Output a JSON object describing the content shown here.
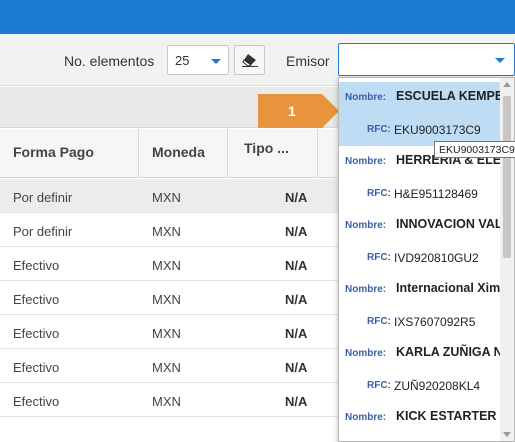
{
  "toolbar": {
    "no_elementos_label": "No. elementos",
    "page_size": "25",
    "emisor_label": "Emisor",
    "emisor_value": ""
  },
  "badge": {
    "label": "1"
  },
  "table": {
    "headers": [
      "Forma Pago",
      "Moneda",
      "Tipo ..."
    ],
    "rows": [
      {
        "forma": "Por definir",
        "moneda": "MXN",
        "tipo": "N/A",
        "selected": true
      },
      {
        "forma": "Por definir",
        "moneda": "MXN",
        "tipo": "N/A",
        "selected": false
      },
      {
        "forma": "Efectivo",
        "moneda": "MXN",
        "tipo": "N/A",
        "selected": false
      },
      {
        "forma": "Efectivo",
        "moneda": "MXN",
        "tipo": "N/A",
        "selected": false
      },
      {
        "forma": "Efectivo",
        "moneda": "MXN",
        "tipo": "N/A",
        "selected": false
      },
      {
        "forma": "Efectivo",
        "moneda": "MXN",
        "tipo": "N/A",
        "selected": false
      },
      {
        "forma": "Efectivo",
        "moneda": "MXN",
        "tipo": "N/A",
        "selected": false
      }
    ]
  },
  "dropdown": {
    "options": [
      {
        "kind": "name",
        "key": "Nombre:",
        "value": "ESCUELA KEMPER",
        "highlighted": true
      },
      {
        "kind": "rfc",
        "key": "RFC:",
        "value": "EKU9003173C9",
        "highlighted": true
      },
      {
        "kind": "name",
        "key": "Nombre:",
        "value": "HERRERIA & ELECTRICOS",
        "highlighted": false
      },
      {
        "kind": "rfc",
        "key": "RFC:",
        "value": "H&E951128469",
        "highlighted": false
      },
      {
        "kind": "name",
        "key": "Nombre:",
        "value": "INNOVACION VALOR",
        "highlighted": false
      },
      {
        "kind": "rfc",
        "key": "RFC:",
        "value": "IVD920810GU2",
        "highlighted": false
      },
      {
        "kind": "name",
        "key": "Nombre:",
        "value": "Internacional Ximba",
        "highlighted": false
      },
      {
        "kind": "rfc",
        "key": "RFC:",
        "value": "IXS7607092R5",
        "highlighted": false
      },
      {
        "kind": "name",
        "key": "Nombre:",
        "value": "KARLA ZUÑIGA NUÑEZ",
        "highlighted": false
      },
      {
        "kind": "rfc",
        "key": "RFC:",
        "value": "ZUÑ920208KL4",
        "highlighted": false
      },
      {
        "kind": "name",
        "key": "Nombre:",
        "value": "KICK ESTARTER LANDING",
        "highlighted": false
      }
    ],
    "tooltip": "EKU9003173C9"
  },
  "colors": {
    "accent": "#1e7bd3",
    "badge": "#e8943c",
    "highlight": "#bfdcf5"
  }
}
